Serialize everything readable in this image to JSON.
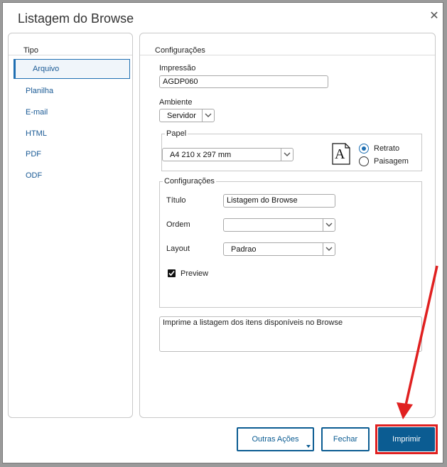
{
  "dialog": {
    "title": "Listagem do Browse"
  },
  "sidebar": {
    "header": "Tipo",
    "items": [
      {
        "label": "Arquivo",
        "selected": true
      },
      {
        "label": "Planilha"
      },
      {
        "label": "E-mail"
      },
      {
        "label": "HTML"
      },
      {
        "label": "PDF"
      },
      {
        "label": "ODF"
      }
    ]
  },
  "main": {
    "header": "Configurações",
    "impressao": {
      "label": "Impressão",
      "value": "AGDP060"
    },
    "ambiente": {
      "label": "Ambiente",
      "value": "Servidor"
    },
    "papel": {
      "legend": "Papel",
      "size": "A4 210 x 297 mm",
      "orientation_icon_glyph": "A",
      "retrato": "Retrato",
      "paisagem": "Paisagem",
      "selected_orientation": "Retrato"
    },
    "config": {
      "legend": "Configurações",
      "titulo": {
        "label": "Título",
        "value": "Listagem do Browse"
      },
      "ordem": {
        "label": "Ordem",
        "value": ""
      },
      "layout": {
        "label": "Layout",
        "value": "Padrao"
      },
      "preview": {
        "label": "Preview",
        "checked": true
      }
    },
    "description": "Imprime a listagem dos itens disponíveis no Browse"
  },
  "footer": {
    "outras_acoes": "Outras Ações",
    "fechar": "Fechar",
    "imprimir": "Imprimir"
  },
  "colors": {
    "accent": "#0b5c92",
    "link": "#1a5a95",
    "annotation": "#e02020"
  }
}
